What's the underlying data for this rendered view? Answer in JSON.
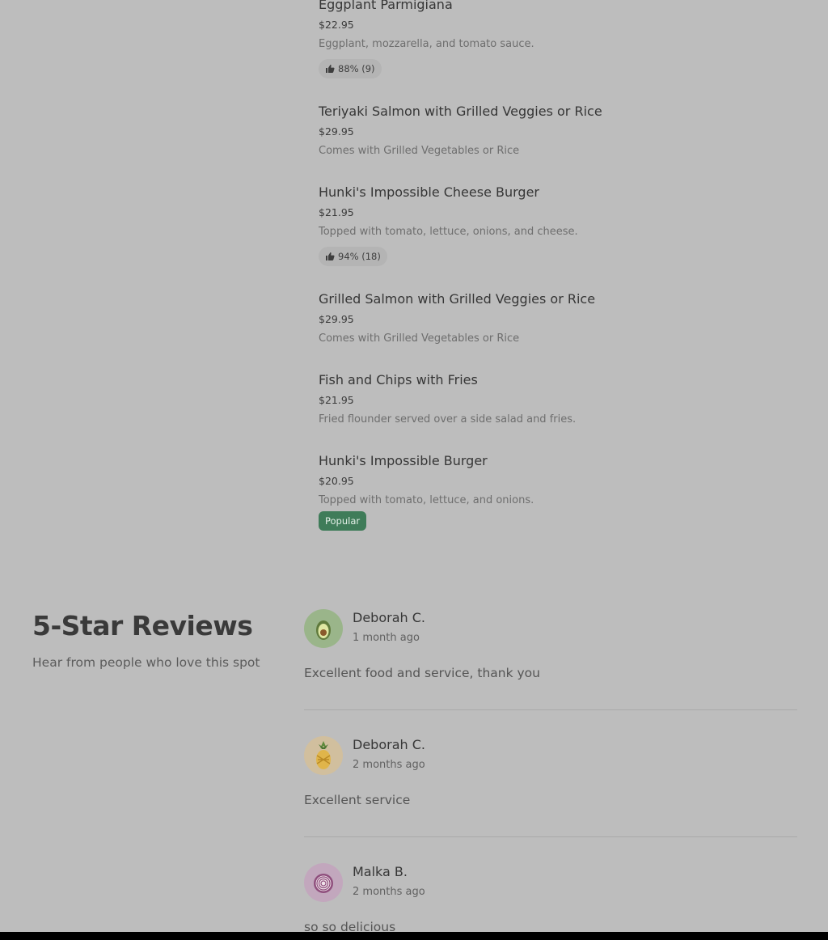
{
  "menu": {
    "items": [
      {
        "name": "Eggplant Parmigiana",
        "price": "$22.95",
        "description": "Eggplant, mozzarella, and tomato sauce.",
        "rating": "88% (9)"
      },
      {
        "name": "Teriyaki Salmon with Grilled Veggies or Rice",
        "price": "$29.95",
        "description": "Comes with Grilled Vegetables or Rice"
      },
      {
        "name": "Hunki's Impossible Cheese Burger",
        "price": "$21.95",
        "description": "Topped with tomato, lettuce, onions, and cheese.",
        "rating": "94% (18)"
      },
      {
        "name": "Grilled Salmon with Grilled Veggies or Rice",
        "price": "$29.95",
        "description": "Comes with Grilled Vegetables or Rice"
      },
      {
        "name": "Fish and Chips with Fries",
        "price": "$21.95",
        "description": "Fried flounder served over a side salad and fries."
      },
      {
        "name": "Hunki's Impossible Burger",
        "price": "$20.95",
        "description": "Topped with tomato, lettuce, and onions.",
        "badge": "Popular"
      }
    ]
  },
  "reviews": {
    "title": "5-Star Reviews",
    "subtitle": "Hear from people who love this spot",
    "items": [
      {
        "name": "Deborah C.",
        "date": "1 month ago",
        "text": "Excellent food and service, thank you",
        "avatar_icon": "avocado-icon"
      },
      {
        "name": "Deborah C.",
        "date": "2 months ago",
        "text": "Excellent service",
        "avatar_icon": "pineapple-icon"
      },
      {
        "name": "Malka B.",
        "date": "2 months ago",
        "text": "so so delicious",
        "avatar_icon": "onion-icon"
      }
    ]
  },
  "colors": {
    "background": "#bdbdbd",
    "popular_badge": "#3f7c59",
    "rating_pill": "#b4b4b4",
    "avatar_avocado_bg": "#9ab58a",
    "avatar_pineapple_bg": "#d1bf9e",
    "avatar_onion_bg": "#c2a7bd"
  }
}
